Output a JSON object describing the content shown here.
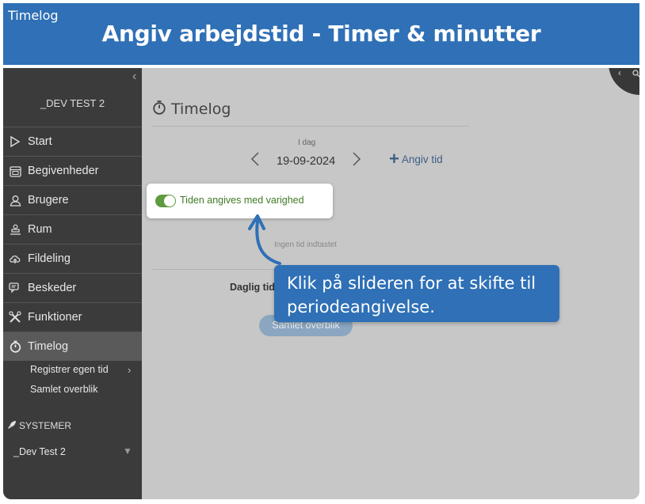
{
  "banner": {
    "app_name": "Timelog",
    "title": "Angiv arbejdstid - Timer & minutter"
  },
  "sidebar": {
    "org_name": "_DEV TEST 2",
    "items": [
      {
        "label": "Start",
        "icon": "play-icon"
      },
      {
        "label": "Begivenheder",
        "icon": "calendar-icon"
      },
      {
        "label": "Brugere",
        "icon": "user-icon"
      },
      {
        "label": "Rum",
        "icon": "room-icon"
      },
      {
        "label": "Fildeling",
        "icon": "cloud-icon"
      },
      {
        "label": "Beskeder",
        "icon": "message-icon"
      },
      {
        "label": "Funktioner",
        "icon": "tools-icon"
      },
      {
        "label": "Timelog",
        "icon": "stopwatch-icon"
      }
    ],
    "subitems": [
      "Registrer egen tid",
      "Samlet overblik"
    ],
    "systems_label": "SYSTEMER",
    "system_item": "_Dev Test 2"
  },
  "main": {
    "title": "Timelog",
    "day_label": "I dag",
    "date": "19-09-2024",
    "add_label": "Angiv tid",
    "toggle_label": "Tiden angives med varighed",
    "toggle_on": true,
    "no_time": "Ingen tid indtastet",
    "daily_label": "Daglig tid",
    "overview_button": "Samlet overblik"
  },
  "callout": {
    "text": "Klik på slideren for at skifte til periodeangivelse."
  },
  "colors": {
    "banner": "#2f70b6",
    "sidebar": "#3b3b3b",
    "toggle_on": "#5f9a3f",
    "content_bg": "#c7c7c7"
  }
}
